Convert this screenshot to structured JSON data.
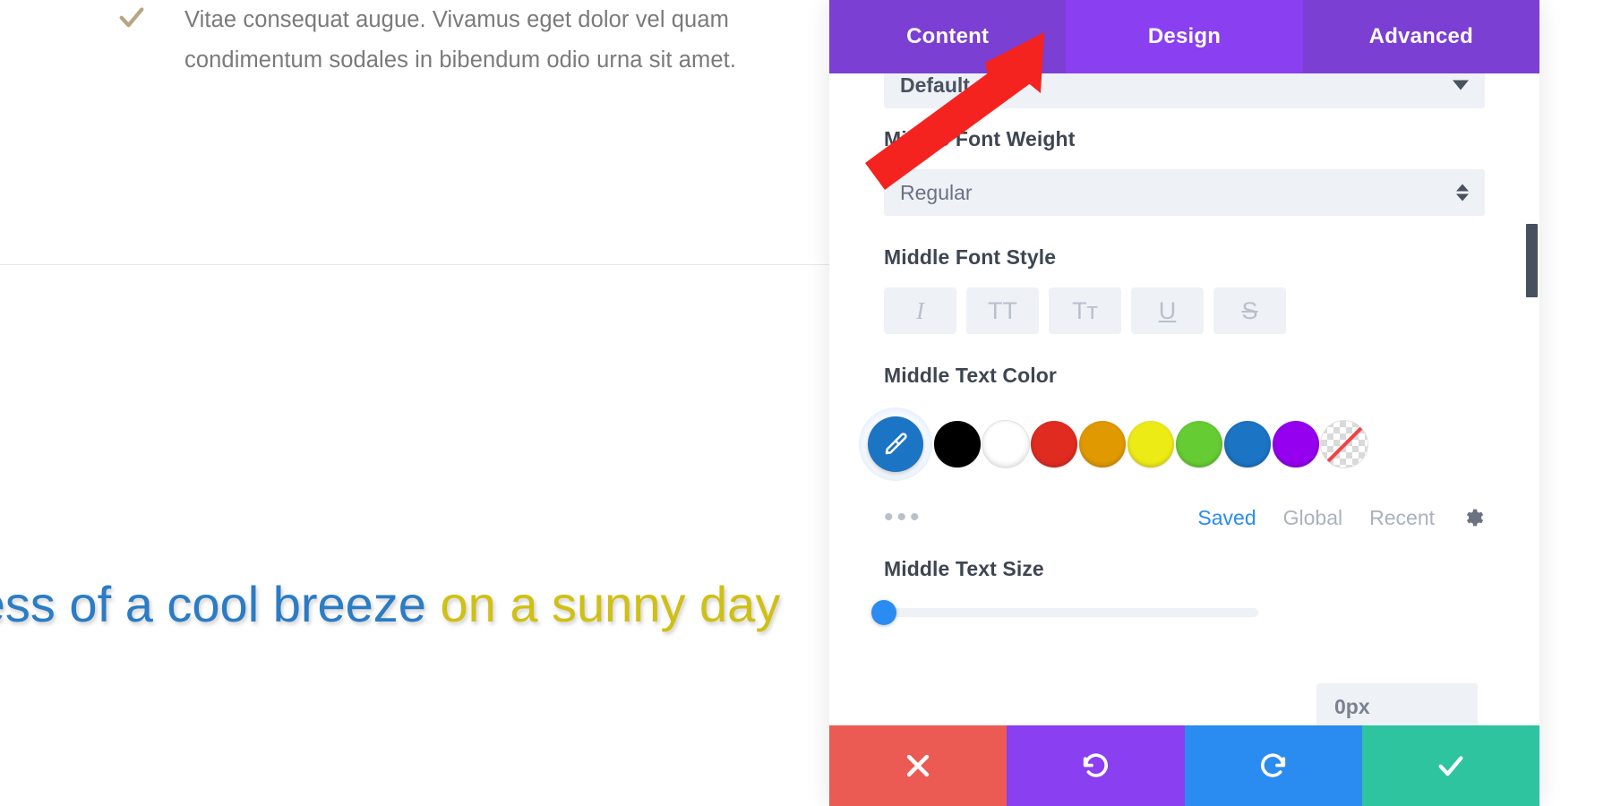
{
  "page": {
    "bullet": {
      "icon": "check-icon",
      "text": "Vitae consequat augue. Vivamus eget dolor vel quam condimentum sodales in bibendum odio urna sit amet."
    },
    "hero": {
      "part_blue": "ispness of a cool breeze",
      "part_yellow": " on a sunny day",
      "color_blue": "#2b7cc4",
      "color_yellow": "#cfc014"
    }
  },
  "modal": {
    "tabs": [
      {
        "label": "Content",
        "active": false
      },
      {
        "label": "Design",
        "active": true
      },
      {
        "label": "Advanced",
        "active": false
      }
    ],
    "accent_purple": "#7b3fd3",
    "accent_purple_active": "#8a3ff0",
    "fields": {
      "clipped_select": {
        "value": "Default"
      },
      "font_weight": {
        "label": "Middle Font Weight",
        "value": "Regular"
      },
      "font_style": {
        "label": "Middle Font Style",
        "buttons": [
          {
            "name": "italic-button",
            "glyph": "I"
          },
          {
            "name": "uppercase-button",
            "glyph": "TT"
          },
          {
            "name": "small-caps-button",
            "glyph": "Tт"
          },
          {
            "name": "underline-button",
            "glyph": "U"
          },
          {
            "name": "strikethrough-button",
            "glyph": "S"
          }
        ]
      },
      "text_color": {
        "label": "Middle Text Color",
        "picker_color": "#1c74c4",
        "swatches": [
          {
            "name": "swatch-black",
            "hex": "#000000"
          },
          {
            "name": "swatch-white",
            "hex": "#ffffff"
          },
          {
            "name": "swatch-red",
            "hex": "#e02b20"
          },
          {
            "name": "swatch-orange",
            "hex": "#e09900"
          },
          {
            "name": "swatch-yellow",
            "hex": "#edeb16"
          },
          {
            "name": "swatch-green",
            "hex": "#66cc33"
          },
          {
            "name": "swatch-blue",
            "hex": "#1c74c4"
          },
          {
            "name": "swatch-purple",
            "hex": "#9500ef"
          },
          {
            "name": "swatch-transparent",
            "hex": "transparent"
          }
        ],
        "links": [
          {
            "label": "Saved",
            "active": true
          },
          {
            "label": "Global",
            "active": false
          },
          {
            "label": "Recent",
            "active": false
          }
        ],
        "more_dots": "•••",
        "settings_icon": "gear-icon"
      },
      "text_size": {
        "label": "Middle Text Size",
        "value": "0px",
        "slider_percent": 0
      }
    },
    "actions": [
      {
        "name": "cancel-button",
        "icon": "close-icon",
        "color": "#eb5b53"
      },
      {
        "name": "undo-button",
        "icon": "undo-icon",
        "color": "#8a3ff0"
      },
      {
        "name": "redo-button",
        "icon": "redo-icon",
        "color": "#2a8cf0"
      },
      {
        "name": "save-button",
        "icon": "check-icon",
        "color": "#2ec4a0"
      }
    ]
  },
  "annotation": {
    "arrow_color": "#f4231f",
    "points_to": "Design"
  }
}
